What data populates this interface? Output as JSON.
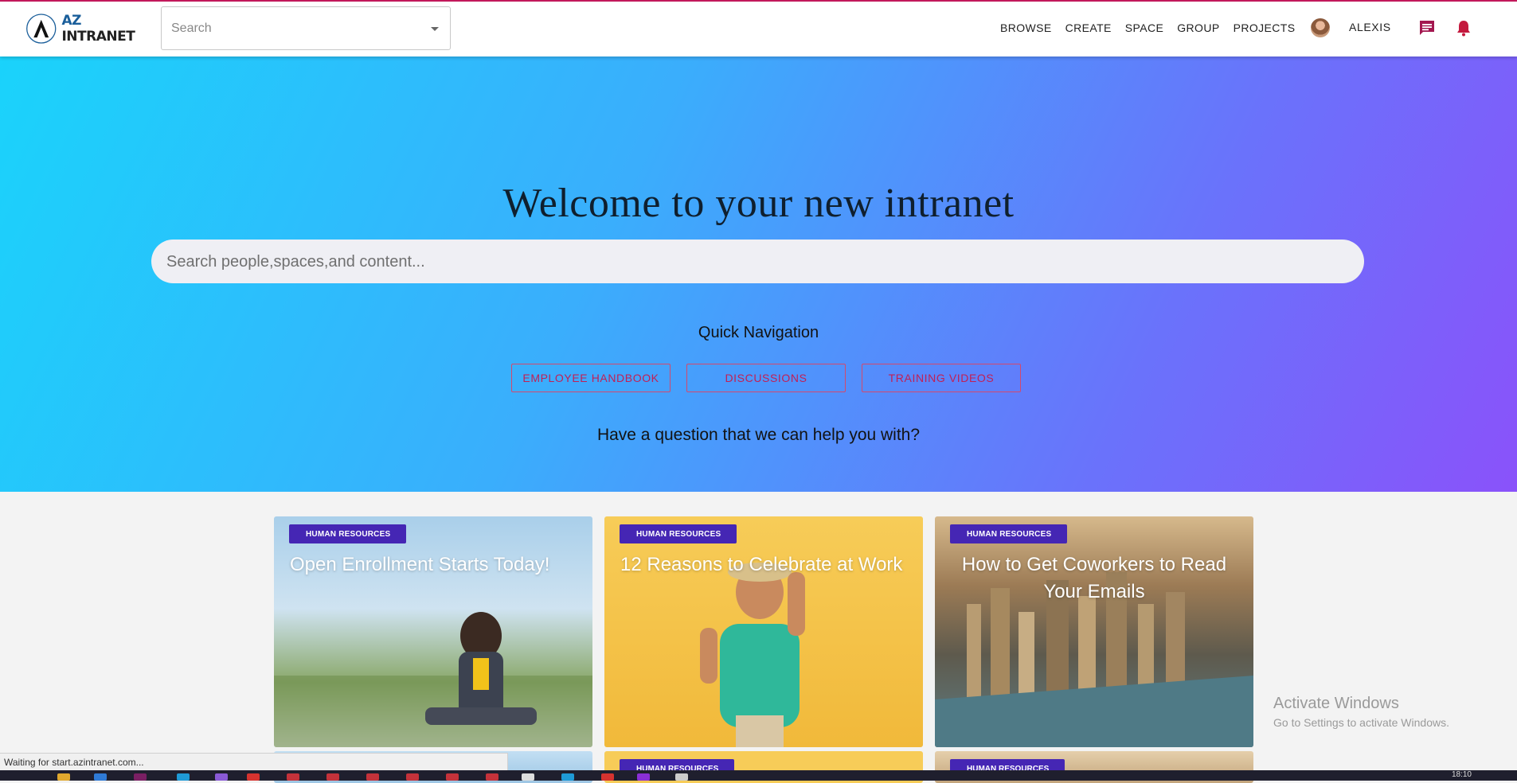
{
  "header": {
    "logo_text": "AZ INTRANET",
    "search_placeholder": "Search",
    "nav": [
      "BROWSE",
      "CREATE",
      "SPACE",
      "GROUP",
      "PROJECTS"
    ],
    "username": "ALEXIS",
    "icons": {
      "chat": "chat-icon",
      "notifications": "bell-icon"
    },
    "accent_color": "#c2185b"
  },
  "hero": {
    "title": "Welcome to your new intranet",
    "search_placeholder": "Search people,spaces,and content...",
    "quick_nav_title": "Quick Navigation",
    "quick_nav_buttons": [
      "EMPLOYEE HANDBOOK",
      "DISCUSSIONS",
      "TRAINING VIDEOS"
    ],
    "question": "Have a question that we can help you with?"
  },
  "cards": [
    {
      "category": "HUMAN RESOURCES",
      "title": "Open Enrollment Starts Today!"
    },
    {
      "category": "HUMAN RESOURCES",
      "title": "12 Reasons to Celebrate at Work"
    },
    {
      "category": "HUMAN RESOURCES",
      "title": "How to Get Coworkers to Read Your Emails"
    }
  ],
  "cards_row2": [
    {
      "category": ""
    },
    {
      "category": "HUMAN RESOURCES"
    },
    {
      "category": "HUMAN RESOURCES"
    }
  ],
  "watermark": {
    "line1": "Activate Windows",
    "line2": "Go to Settings to activate Windows."
  },
  "status_bar": {
    "text": "Waiting for start.azintranet.com..."
  },
  "taskbar": {
    "time": "18:10"
  }
}
